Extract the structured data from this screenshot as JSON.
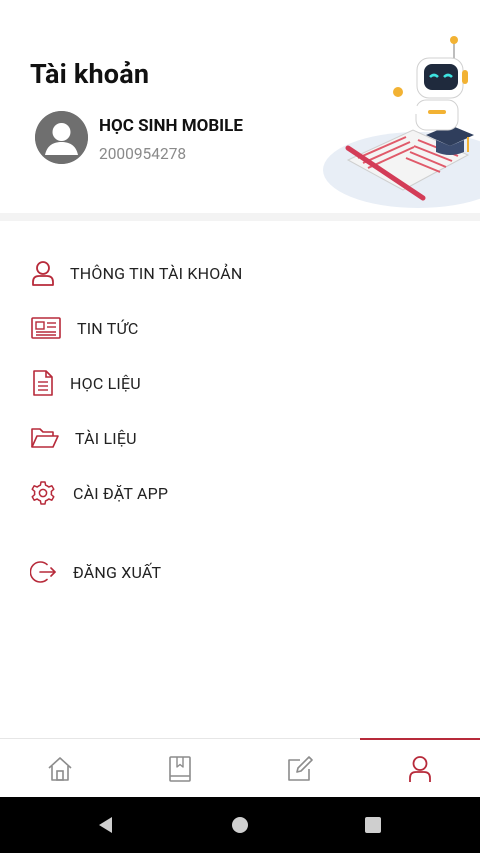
{
  "header": {
    "title": "Tài khoản",
    "user_name": "HỌC SINH MOBILE",
    "user_id": "2000954278"
  },
  "menu": {
    "account_info": "THÔNG TIN TÀI KHOẢN",
    "news": "TIN TỨC",
    "learning_materials": "HỌC LIỆU",
    "documents": "TÀI LIỆU",
    "app_settings": "CÀI ĐẶT APP",
    "logout": "ĐĂNG XUẤT"
  },
  "colors": {
    "accent": "#b72a3a",
    "icon_gray": "#8c8c8c",
    "system_bar": "#000000"
  },
  "bottom_nav": {
    "tabs": [
      "home-icon",
      "book-icon",
      "edit-icon",
      "user-icon"
    ],
    "active_tab": "user-icon"
  }
}
